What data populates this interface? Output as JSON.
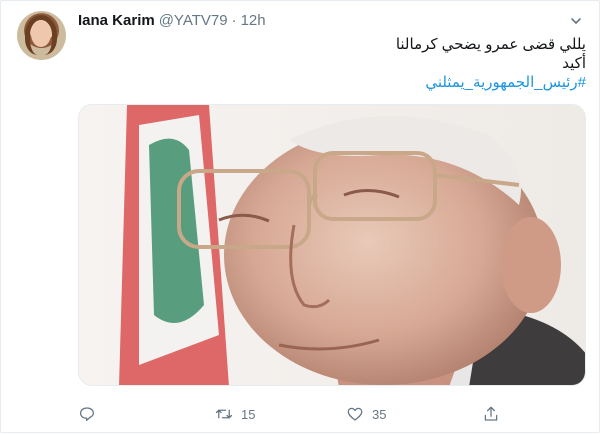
{
  "tweet": {
    "author_name": "Iana Karim",
    "handle": "@YATV79",
    "separator": "·",
    "time": "12h",
    "text_line1": "يللي قضى عمرو يضحي كرمالنا",
    "text_line2": "أكيد",
    "hashtag": "#رئيس_الجمهورية_يمثلني"
  },
  "actions": {
    "reply_count": "",
    "retweet_count": "15",
    "like_count": "35"
  },
  "icons": [
    "chevron-down-icon",
    "reply-icon",
    "retweet-icon",
    "like-icon",
    "share-icon"
  ],
  "colors": {
    "link": "#1b95e0",
    "secondary_text": "#657786",
    "border": "#e6ecf0"
  }
}
